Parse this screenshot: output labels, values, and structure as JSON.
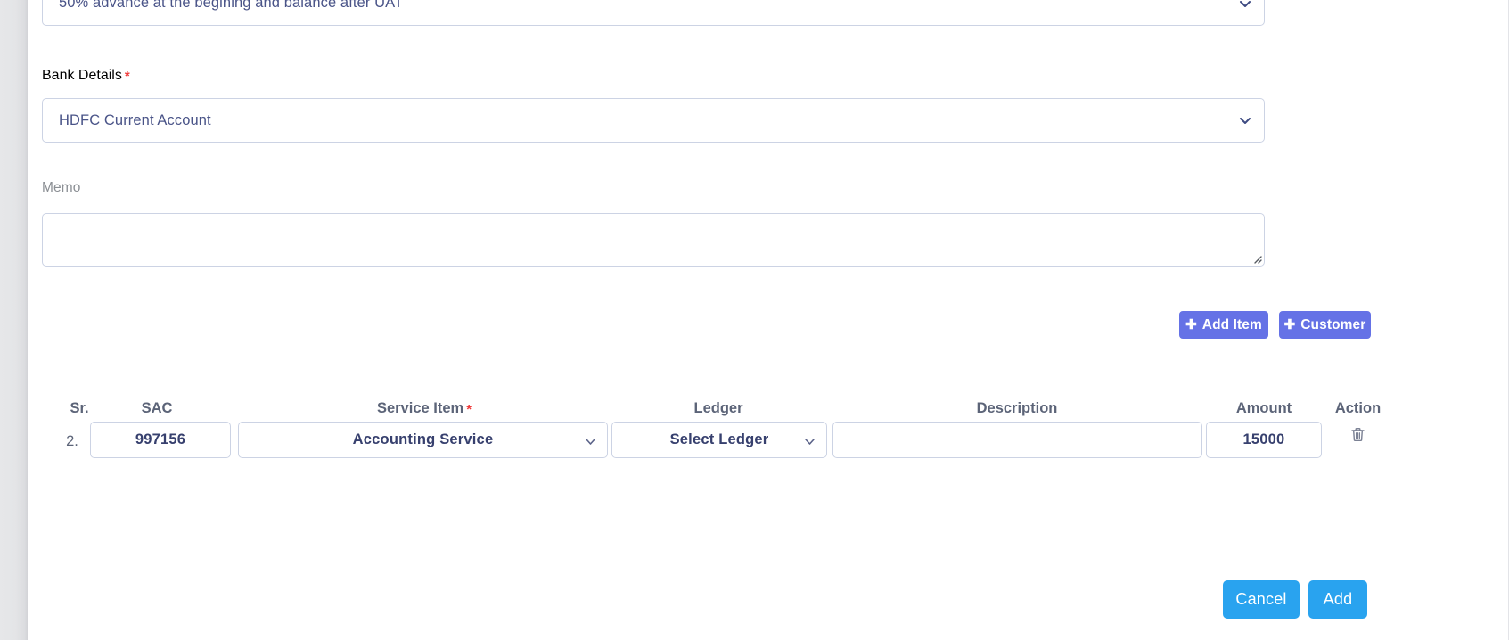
{
  "form": {
    "payment_terms": {
      "value": "50% advance at the begining and balance after UAT",
      "chevron_icon": "chevron-down-icon"
    },
    "bank_details": {
      "label": "Bank Details",
      "required_marker": "*",
      "value": "HDFC Current Account",
      "chevron_icon": "chevron-down-icon"
    },
    "memo": {
      "label": "Memo",
      "value": "",
      "placeholder": ""
    }
  },
  "toolbar": {
    "add_item_label": "Add Item",
    "add_customer_label": "Customer",
    "plus_glyph": "✚",
    "accent_color": "#6572e6"
  },
  "items_table": {
    "columns": [
      {
        "key": "sr",
        "label": "Sr.",
        "required": false
      },
      {
        "key": "sac",
        "label": "SAC",
        "required": false
      },
      {
        "key": "service_item",
        "label": "Service Item",
        "required": true
      },
      {
        "key": "ledger",
        "label": "Ledger",
        "required": false
      },
      {
        "key": "description",
        "label": "Description",
        "required": false
      },
      {
        "key": "amount",
        "label": "Amount",
        "required": false
      },
      {
        "key": "action",
        "label": "Action",
        "required": false
      }
    ],
    "required_marker": "*",
    "rows": [
      {
        "sr": "2.",
        "sac": "997156",
        "service_item": "Accounting Service",
        "ledger": "Select Ledger",
        "description": "",
        "amount": "15000",
        "action_icon": "trash-icon"
      }
    ]
  },
  "footer": {
    "cancel_label": "Cancel",
    "add_label": "Add",
    "accent_color": "#29a3ef"
  }
}
